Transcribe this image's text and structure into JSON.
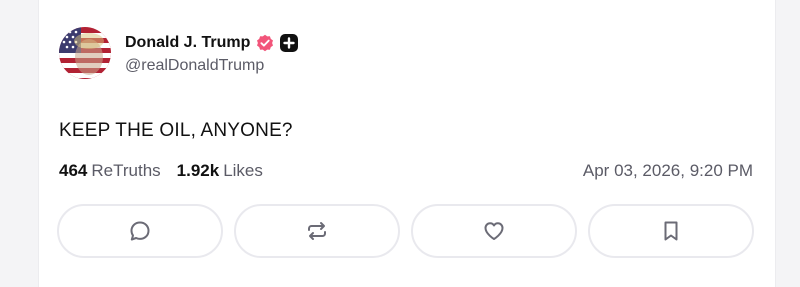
{
  "post": {
    "author": {
      "display_name": "Donald J. Trump",
      "handle": "@realDonaldTrump",
      "avatar_icon": "flag-portrait-avatar",
      "verified_icon": "verified-badge-icon",
      "verified_color": "#f2557a",
      "plus_icon": "plus-badge-icon"
    },
    "text": "KEEP THE OIL, ANYONE?",
    "stats": {
      "retruths_count": "464",
      "retruths_label": "ReTruths",
      "likes_count": "1.92k",
      "likes_label": "Likes"
    },
    "timestamp": "Apr 03, 2026, 9:20 PM",
    "actions": [
      {
        "name": "reply",
        "icon": "reply-icon"
      },
      {
        "name": "retruth",
        "icon": "retruth-icon"
      },
      {
        "name": "like",
        "icon": "heart-icon"
      },
      {
        "name": "bookmark",
        "icon": "bookmark-icon"
      }
    ]
  },
  "colors": {
    "text_primary": "#111111",
    "text_secondary": "#5b5b66",
    "border": "#e9e9ee",
    "icon": "#6b6b76"
  }
}
